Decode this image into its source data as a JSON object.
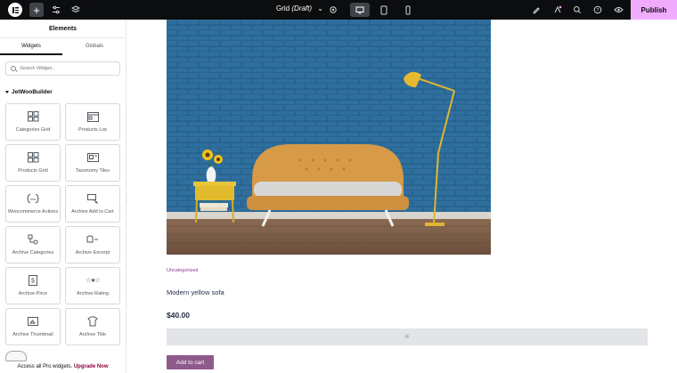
{
  "topbar": {
    "document_name": "Grid",
    "document_status": "(Draft)",
    "publish_label": "Publish",
    "accent_color": "#f0abfc"
  },
  "panel": {
    "title": "Elements",
    "tabs": [
      {
        "label": "Widgets",
        "active": true
      },
      {
        "label": "Globals",
        "active": false
      }
    ],
    "search_placeholder": "Search Widget...",
    "category": "JetWooBuilder",
    "widgets": [
      {
        "label": "Categories Grid",
        "icon": "categories-grid-icon"
      },
      {
        "label": "Products List",
        "icon": "products-list-icon"
      },
      {
        "label": "Products Grid",
        "icon": "products-grid-icon"
      },
      {
        "label": "Taxonomy Tiles",
        "icon": "taxonomy-tiles-icon"
      },
      {
        "label": "Woocommerce Actions",
        "icon": "shortcode-icon"
      },
      {
        "label": "Archive Add to Cart",
        "icon": "add-to-cart-icon"
      },
      {
        "label": "Archive Categories",
        "icon": "categories-icon"
      },
      {
        "label": "Archive Excerpt",
        "icon": "excerpt-icon"
      },
      {
        "label": "Archive Price",
        "icon": "price-icon"
      },
      {
        "label": "Archive Rating",
        "icon": "rating-icon"
      },
      {
        "label": "Archive Thumbnail",
        "icon": "thumbnail-icon"
      },
      {
        "label": "Archive Title",
        "icon": "title-icon"
      }
    ],
    "promo_text": "Access all Pro widgets.",
    "promo_link": "Upgrade Now"
  },
  "product": {
    "category": "Uncategorized",
    "title": "Modern yellow sofa",
    "price": "$40.00",
    "add_to_cart_label": "Add to cart"
  }
}
